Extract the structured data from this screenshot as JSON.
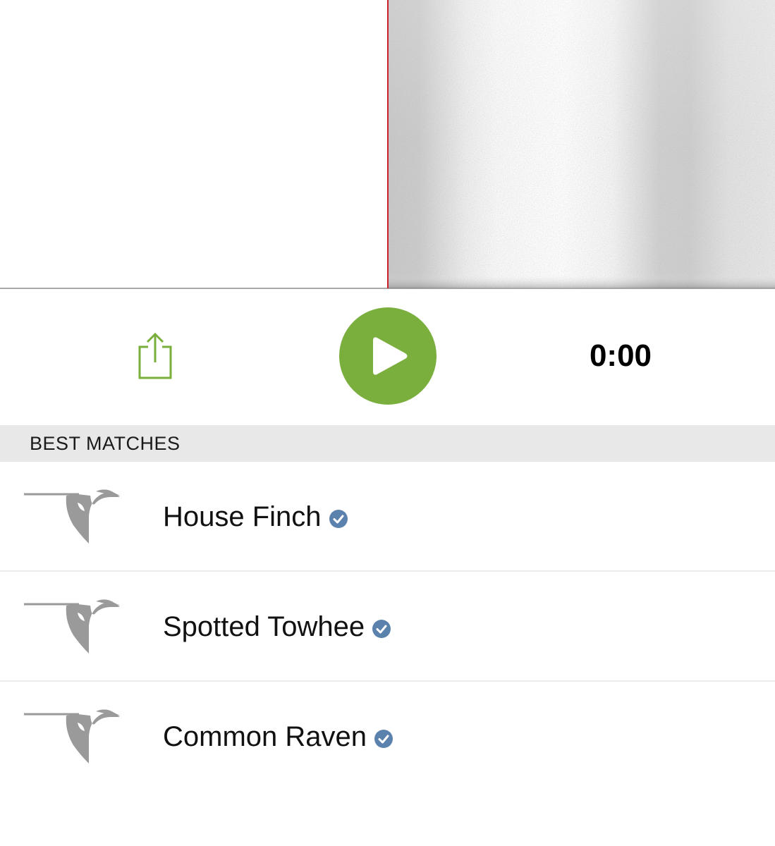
{
  "player": {
    "time": "0:00",
    "colors": {
      "accent": "#7aaf3e",
      "playhead": "#cc1f2a",
      "verified": "#5b82ad"
    },
    "icons": {
      "share": "share-icon",
      "play": "play-icon"
    }
  },
  "section": {
    "title": "BEST MATCHES"
  },
  "matches": [
    {
      "name": "House Finch",
      "verified": true,
      "icon": "bird-silhouette-icon"
    },
    {
      "name": "Spotted Towhee",
      "verified": true,
      "icon": "bird-silhouette-icon"
    },
    {
      "name": "Common Raven",
      "verified": true,
      "icon": "bird-silhouette-icon"
    }
  ]
}
